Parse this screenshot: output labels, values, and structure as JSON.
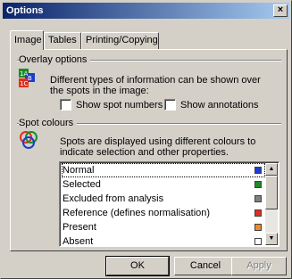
{
  "window": {
    "title": "Options",
    "close_glyph": "×"
  },
  "tabs": [
    {
      "label": "Image"
    },
    {
      "label": "Tables"
    },
    {
      "label": "Printing/Copying"
    }
  ],
  "overlay": {
    "group_label": "Overlay options",
    "description": "Different types of information can be shown over the spots in the image:",
    "show_spot_numbers": "Show spot numbers",
    "show_annotations": "Show annotations",
    "icon": "numbered-layers-icon"
  },
  "spot_colours": {
    "group_label": "Spot colours",
    "description": "Spots are displayed using different colours to indicate selection and other properties.",
    "icon": "color-rings-icon",
    "items": [
      {
        "label": "Normal",
        "color": "#1a3fcc"
      },
      {
        "label": "Selected",
        "color": "#1e8a2a"
      },
      {
        "label": "Excluded from analysis",
        "color": "#808080"
      },
      {
        "label": "Reference (defines normalisation)",
        "color": "#e0301e"
      },
      {
        "label": "Present",
        "color": "#f08a2a"
      },
      {
        "label": "Absent",
        "color": "#ffffff"
      }
    ]
  },
  "buttons": {
    "ok": "OK",
    "cancel": "Cancel",
    "apply": "Apply"
  }
}
